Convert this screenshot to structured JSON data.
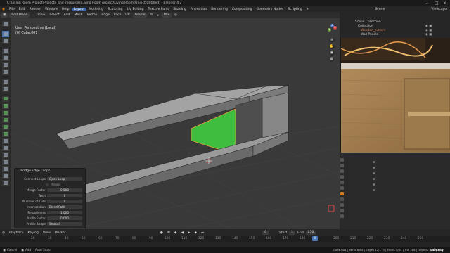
{
  "window": {
    "title": "C:\\Living Room Project\\Projects_and_resources\\Living Room project\\Living Room Project\\Untitled) - Blender 4.2"
  },
  "menu": {
    "items": [
      "File",
      "Edit",
      "Render",
      "Window",
      "Help"
    ],
    "workspaces": [
      "Layout",
      "Modeling",
      "Sculpting",
      "UV Editing",
      "Texture Paint",
      "Shading",
      "Animation",
      "Rendering",
      "Compositing",
      "Geometry Nodes",
      "Scripting"
    ],
    "active_workspace": "Layout",
    "scene_label": "Scene",
    "viewlayer_label": "ViewLayer"
  },
  "header": {
    "mode": "Edit Mode",
    "menus": [
      "View",
      "Select",
      "Add",
      "Mesh",
      "Vertex",
      "Edge",
      "Face",
      "UV"
    ],
    "transform_orientation": "Global",
    "snap_label": "Mix",
    "options_label": "Options"
  },
  "viewport": {
    "view_name": "User Perspective (Local)",
    "object_name": "(0) Cube.001",
    "axis_labels": [
      "X",
      "Y",
      "Z"
    ]
  },
  "operator_panel": {
    "title": "Bridge Edge Loops",
    "rows": [
      {
        "label": "Connect Loops",
        "value": "Open Loop"
      },
      {
        "label": "",
        "value": "Merge"
      },
      {
        "label": "Merge Factor",
        "value": "0.500"
      },
      {
        "label": "Twist",
        "value": "0"
      },
      {
        "label": "Number of Cuts",
        "value": "0"
      },
      {
        "label": "Interpolation",
        "value": "Blend Path"
      },
      {
        "label": "Smoothness",
        "value": "1.000"
      },
      {
        "label": "Profile Factor",
        "value": "0.000"
      },
      {
        "label": "Profile Shape",
        "value": "Smooth"
      }
    ]
  },
  "outliner": {
    "root": "Scene Collection",
    "items": [
      "Collection",
      "Wooden_cutters",
      "Wall Panels"
    ]
  },
  "timeline": {
    "playback": "Playback",
    "keying": "Keying",
    "view": "View",
    "marker": "Marker",
    "current_frame": "0",
    "start_label": "Start",
    "start": "1",
    "end_label": "End",
    "end": "250",
    "ticks": [
      "10",
      "20",
      "30",
      "40",
      "50",
      "60",
      "70",
      "80",
      "90",
      "100",
      "110",
      "120",
      "130",
      "140",
      "150",
      "160",
      "170",
      "180",
      "190",
      "200",
      "210",
      "220",
      "230",
      "240",
      "250"
    ]
  },
  "status": {
    "cancel": "Cancel",
    "add": "Add",
    "auto_snap": "Auto Snap",
    "stats": "Cube.001 | Verts 8/84 | Edges 12/173 | Faces 4/84 | Tris 168 | Objects 1/19 | 4.2.1",
    "watermark": "udemy"
  },
  "colors": {
    "accent": "#4772b3",
    "selected_face": "#3fcc3f",
    "mesh": "#8d8d8d"
  }
}
